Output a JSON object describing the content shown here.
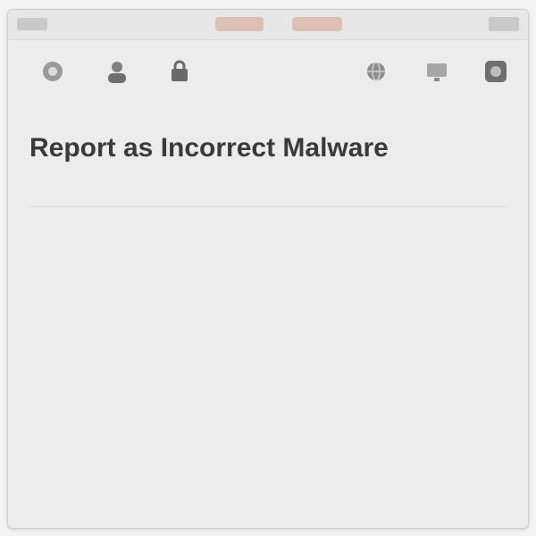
{
  "window": {
    "tabs": [
      "",
      ""
    ]
  },
  "toolbar": {
    "items": [
      {
        "icon": "general-icon",
        "label": ""
      },
      {
        "icon": "accounts-icon",
        "label": ""
      },
      {
        "icon": "security-icon",
        "label": ""
      },
      {
        "icon": "network-icon",
        "label": ""
      },
      {
        "icon": "display-icon",
        "label": ""
      },
      {
        "icon": "advanced-icon",
        "label": ""
      }
    ]
  },
  "main": {
    "title": "Report as Incorrect Malware",
    "paragraph": [
      "",
      "",
      "",
      "",
      "",
      "",
      ""
    ],
    "section_title": "",
    "list_items": [
      "",
      "",
      "",
      "",
      "",
      ""
    ],
    "footnote": [
      "",
      ""
    ]
  },
  "colors": {
    "accent_tab": "#d9b7ad",
    "title": "#3a3a3a",
    "body_text": "#777777"
  }
}
